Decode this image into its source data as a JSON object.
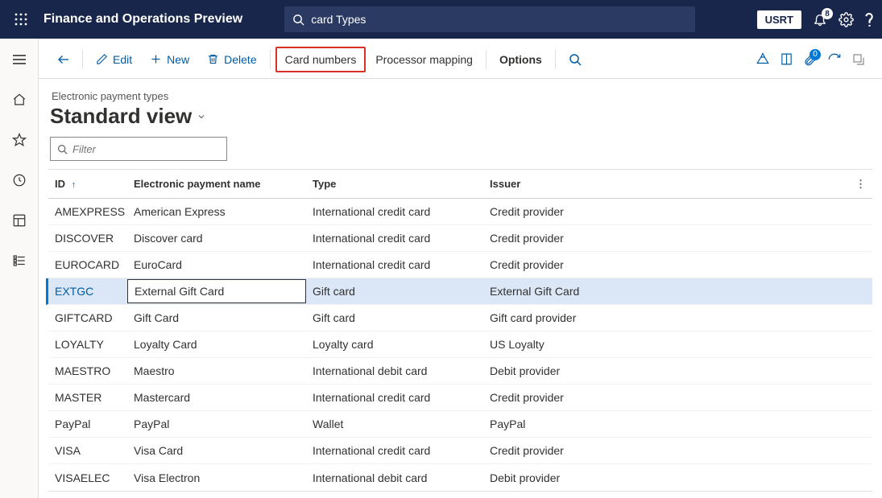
{
  "header": {
    "app_title": "Finance and Operations Preview",
    "search_value": "card Types",
    "company": "USRT",
    "notification_count": "8"
  },
  "toolbar": {
    "edit_label": "Edit",
    "new_label": "New",
    "delete_label": "Delete",
    "card_numbers_label": "Card numbers",
    "processor_mapping_label": "Processor mapping",
    "options_label": "Options",
    "attachments_count": "0"
  },
  "page": {
    "breadcrumb": "Electronic payment types",
    "view_title": "Standard view",
    "filter_placeholder": "Filter"
  },
  "grid": {
    "columns": {
      "id": "ID",
      "name": "Electronic payment name",
      "type": "Type",
      "issuer": "Issuer"
    },
    "rows": [
      {
        "id": "AMEXPRESS",
        "name": "American Express",
        "type": "International credit card",
        "issuer": "Credit provider"
      },
      {
        "id": "DISCOVER",
        "name": "Discover card",
        "type": "International credit card",
        "issuer": "Credit provider"
      },
      {
        "id": "EUROCARD",
        "name": "EuroCard",
        "type": "International credit card",
        "issuer": "Credit provider"
      },
      {
        "id": "EXTGC",
        "name": "External Gift Card",
        "type": "Gift card",
        "issuer": "External Gift Card",
        "selected": true
      },
      {
        "id": "GIFTCARD",
        "name": "Gift Card",
        "type": "Gift card",
        "issuer": "Gift card provider"
      },
      {
        "id": "LOYALTY",
        "name": "Loyalty Card",
        "type": "Loyalty card",
        "issuer": "US Loyalty"
      },
      {
        "id": "MAESTRO",
        "name": "Maestro",
        "type": "International debit card",
        "issuer": "Debit provider"
      },
      {
        "id": "MASTER",
        "name": "Mastercard",
        "type": "International credit card",
        "issuer": "Credit provider"
      },
      {
        "id": "PayPal",
        "name": "PayPal",
        "type": "Wallet",
        "issuer": "PayPal"
      },
      {
        "id": "VISA",
        "name": "Visa Card",
        "type": "International credit card",
        "issuer": "Credit provider"
      },
      {
        "id": "VISAELEC",
        "name": "Visa Electron",
        "type": "International debit card",
        "issuer": "Debit provider"
      }
    ]
  }
}
